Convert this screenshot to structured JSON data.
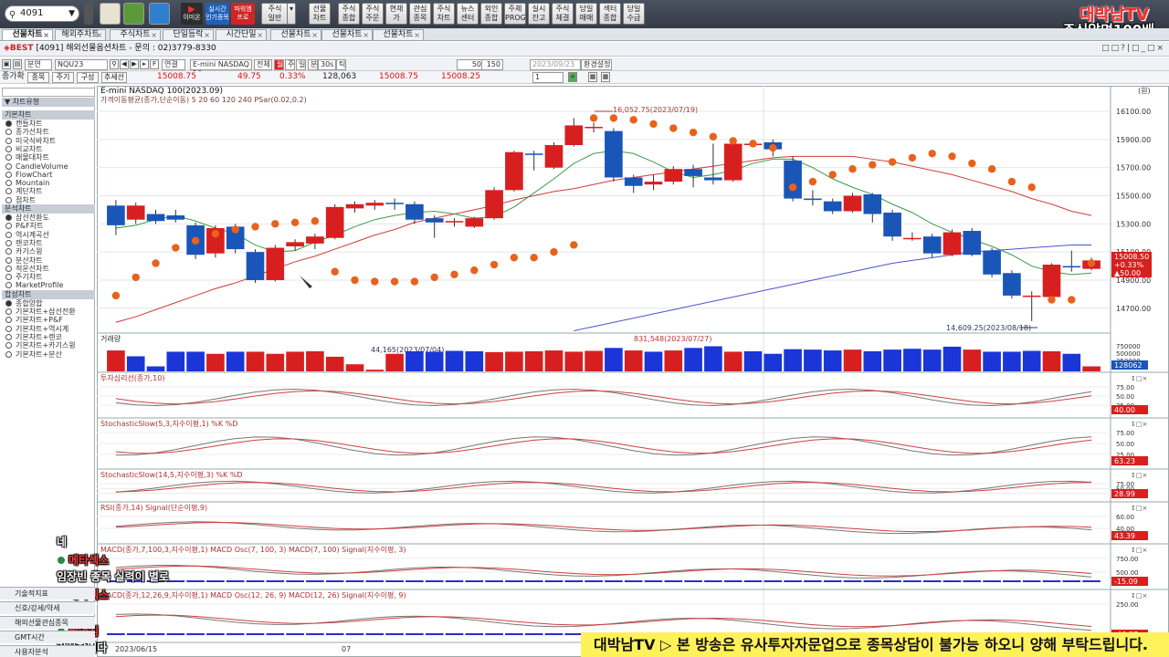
{
  "toolbar": {
    "code_value": "4091",
    "buttons": [
      "주식\n일반",
      "선물\n차트",
      "주식\n종합",
      "주식\n주문",
      "현재\n가",
      "관심\n종목",
      "주식\n차트",
      "뉴스\n센터",
      "외인\n종합",
      "주체\nPROG",
      "실시\n잔고",
      "주식\n체결",
      "당일\n매매",
      "섹터\n종합",
      "당일\n수급"
    ],
    "youtube_label": "이미온",
    "live_label": "실시간\n인기종목",
    "power_label": "파워엠\n프로"
  },
  "brand": {
    "line1": "대박남TV",
    "line2": "주식알면100배"
  },
  "tabs": [
    {
      "label": "선물차트",
      "active": true
    },
    {
      "label": "해외주차트"
    },
    {
      "label": "주식차트"
    },
    {
      "label": "단일등락"
    },
    {
      "label": "시간단일"
    },
    {
      "label": "선물차트"
    },
    {
      "label": "선물차트"
    },
    {
      "label": "선물차트"
    }
  ],
  "window": {
    "title": "[4091] 해외선물옵션차트 - 문의 : 02)3779-8330"
  },
  "controls": {
    "period": "분연",
    "symbol": "NQU23",
    "product": "E-mini NASDAQ 10",
    "all": "전체",
    "units": [
      "월",
      "주",
      "일",
      "분",
      "30s",
      "틱"
    ],
    "count1": "50",
    "count2": "150",
    "date": "2023/09/23",
    "setting": "환경설정",
    "page": "1"
  },
  "quote": {
    "label": "종가확",
    "btn1": "종목",
    "btn2": "주기",
    "btn3": "구성",
    "btn4": "추세선",
    "price": "15008.75",
    "change": "49.75",
    "pct": "0.33%",
    "volume": "128,063",
    "p2": "15008.75",
    "p3": "15008.25"
  },
  "sidebar": {
    "sections": [
      {
        "head": "차트유형",
        "items": []
      },
      {
        "head": "기본차트",
        "items": [
          "캔들차트",
          "종가선차트",
          "미국식바차트",
          "비교차트",
          "매물대차트",
          "CandleVolume",
          "FlowChart",
          "Mountain",
          "계단차트",
          "점차트"
        ]
      },
      {
        "head": "분석차트",
        "items": [
          "삼선전환도",
          "P&F차트",
          "역시계곡선",
          "렌코차트",
          "카기스윙",
          "분산차트",
          "적운선차트",
          "주기차트",
          "MarketProfile"
        ]
      },
      {
        "head": "합성차트",
        "items": [
          "종합양합",
          "기본차트+삼선전환",
          "기본차트+P&F",
          "기본차트+역시계",
          "기본차트+렌코",
          "기본차트+카기스윙",
          "기본차트+분산"
        ]
      }
    ],
    "bottom": [
      "기술적지표",
      "신호/강세/약세",
      "해외선물관심종목",
      "GMT시간",
      "사용자분석"
    ]
  },
  "chart_data": [
    {
      "type": "candlestick",
      "title": "E-mini NASDAQ 100(2023.09)",
      "legend": "가격이동평균(종가,단순이동) 5 20 60 120 240   PSar(0.02,0.2)",
      "y_ticks": [
        16100,
        15900,
        15700,
        15500,
        15300,
        15100,
        14900,
        14700
      ],
      "ylim": [
        14530,
        16230
      ],
      "annotations": [
        "16,052.75(2023/07/19)",
        "14,609.25(2023/08/18)"
      ],
      "current": [
        "15008.50",
        "+0.33%",
        "▲50.00"
      ],
      "candles": [
        {
          "o": 15430,
          "c": 15290,
          "h": 15470,
          "l": 15220
        },
        {
          "o": 15330,
          "c": 15430,
          "h": 15450,
          "l": 15300
        },
        {
          "o": 15370,
          "c": 15320,
          "h": 15400,
          "l": 15300
        },
        {
          "o": 15360,
          "c": 15330,
          "h": 15400,
          "l": 15310
        },
        {
          "o": 15290,
          "c": 15080,
          "h": 15310,
          "l": 15050
        },
        {
          "o": 15090,
          "c": 15270,
          "h": 15290,
          "l": 15060
        },
        {
          "o": 15280,
          "c": 15120,
          "h": 15300,
          "l": 15090
        },
        {
          "o": 15100,
          "c": 14900,
          "h": 15120,
          "l": 14880
        },
        {
          "o": 14900,
          "c": 15130,
          "h": 15150,
          "l": 14890
        },
        {
          "o": 15140,
          "c": 15170,
          "h": 15190,
          "l": 15110
        },
        {
          "o": 15160,
          "c": 15210,
          "h": 15230,
          "l": 15120
        },
        {
          "o": 15200,
          "c": 15420,
          "h": 15440,
          "l": 15190
        },
        {
          "o": 15410,
          "c": 15440,
          "h": 15460,
          "l": 15380
        },
        {
          "o": 15430,
          "c": 15450,
          "h": 15470,
          "l": 15400
        },
        {
          "o": 15450,
          "c": 15440,
          "h": 15480,
          "l": 15400
        },
        {
          "o": 15440,
          "c": 15330,
          "h": 15460,
          "l": 15300
        },
        {
          "o": 15340,
          "c": 15310,
          "h": 15360,
          "l": 15200
        },
        {
          "o": 15310,
          "c": 15320,
          "h": 15340,
          "l": 15280
        },
        {
          "o": 15280,
          "c": 15340,
          "h": 15350,
          "l": 15270
        },
        {
          "o": 15340,
          "c": 15540,
          "h": 15560,
          "l": 15330
        },
        {
          "o": 15540,
          "c": 15810,
          "h": 15820,
          "l": 15530
        },
        {
          "o": 15800,
          "c": 15790,
          "h": 15820,
          "l": 15680
        },
        {
          "o": 15700,
          "c": 15860,
          "h": 15880,
          "l": 15690
        },
        {
          "o": 15860,
          "c": 16000,
          "h": 16052,
          "l": 15850
        },
        {
          "o": 15990,
          "c": 15990,
          "h": 16020,
          "l": 15950
        },
        {
          "o": 15960,
          "c": 15630,
          "h": 15980,
          "l": 15600
        },
        {
          "o": 15630,
          "c": 15570,
          "h": 15650,
          "l": 15520
        },
        {
          "o": 15580,
          "c": 15600,
          "h": 15650,
          "l": 15540
        },
        {
          "o": 15600,
          "c": 15690,
          "h": 15710,
          "l": 15580
        },
        {
          "o": 15690,
          "c": 15640,
          "h": 15720,
          "l": 15560
        },
        {
          "o": 15630,
          "c": 15610,
          "h": 15870,
          "l": 15580
        },
        {
          "o": 15610,
          "c": 15870,
          "h": 15890,
          "l": 15600
        },
        {
          "o": 15870,
          "c": 15870,
          "h": 15890,
          "l": 15850
        },
        {
          "o": 15880,
          "c": 15830,
          "h": 15900,
          "l": 15780
        },
        {
          "o": 15750,
          "c": 15480,
          "h": 15780,
          "l": 15460
        },
        {
          "o": 15480,
          "c": 15470,
          "h": 15540,
          "l": 15430
        },
        {
          "o": 15460,
          "c": 15390,
          "h": 15480,
          "l": 15370
        },
        {
          "o": 15390,
          "c": 15500,
          "h": 15520,
          "l": 15380
        },
        {
          "o": 15510,
          "c": 15370,
          "h": 15520,
          "l": 15310
        },
        {
          "o": 15380,
          "c": 15210,
          "h": 15400,
          "l": 15180
        },
        {
          "o": 15200,
          "c": 15200,
          "h": 15240,
          "l": 15180
        },
        {
          "o": 15210,
          "c": 15090,
          "h": 15230,
          "l": 15060
        },
        {
          "o": 15080,
          "c": 15240,
          "h": 15260,
          "l": 15070
        },
        {
          "o": 15250,
          "c": 15080,
          "h": 15270,
          "l": 15070
        },
        {
          "o": 15110,
          "c": 14940,
          "h": 15130,
          "l": 14920
        },
        {
          "o": 14950,
          "c": 14790,
          "h": 14970,
          "l": 14770
        },
        {
          "o": 14790,
          "c": 14790,
          "h": 14820,
          "l": 14609
        },
        {
          "o": 14780,
          "c": 15010,
          "h": 15020,
          "l": 14770
        },
        {
          "o": 15000,
          "c": 14990,
          "h": 15110,
          "l": 14960
        },
        {
          "o": 14980,
          "c": 15040,
          "h": 15060,
          "l": 14970
        }
      ],
      "psar": [
        14790,
        14920,
        15020,
        15130,
        15180,
        15230,
        15260,
        15280,
        15300,
        15310,
        15320,
        14960,
        14900,
        14890,
        14890,
        14890,
        14920,
        14940,
        14970,
        15010,
        15060,
        15060,
        15100,
        15150,
        16052,
        16052,
        16040,
        16010,
        15980,
        15950,
        15920,
        15890,
        15870,
        15840,
        15560,
        15600,
        15650,
        15690,
        15720,
        15740,
        15770,
        15800,
        15780,
        15730,
        15690,
        15600,
        15560,
        14760,
        14760,
        15020
      ],
      "ma_series": [
        {
          "name": "ma20",
          "values": [
            14600,
            14640,
            14690,
            14740,
            14790,
            14840,
            14880,
            14930,
            14980,
            15030,
            15070,
            15120,
            15170,
            15220,
            15260,
            15310,
            15340,
            15370,
            15400,
            15430,
            15470,
            15500,
            15530,
            15550,
            15580,
            15610,
            15630,
            15650,
            15670,
            15690,
            15710,
            15730,
            15750,
            15770,
            15780,
            15780,
            15780,
            15780,
            15760,
            15740,
            15710,
            15680,
            15650,
            15610,
            15570,
            15530,
            15480,
            15440,
            15390,
            15360
          ]
        },
        {
          "name": "ma5",
          "values": [
            15270,
            15290,
            15330,
            15360,
            15320,
            15270,
            15230,
            15150,
            15100,
            15110,
            15170,
            15220,
            15280,
            15330,
            15360,
            15380,
            15390,
            15370,
            15340,
            15350,
            15420,
            15520,
            15620,
            15730,
            15800,
            15820,
            15800,
            15740,
            15670,
            15630,
            15650,
            15680,
            15730,
            15760,
            15760,
            15700,
            15620,
            15560,
            15510,
            15440,
            15380,
            15300,
            15240,
            15190,
            15140,
            15080,
            15000,
            14960,
            14940,
            14950
          ]
        },
        {
          "name": "ma60",
          "values": [
            null,
            null,
            null,
            null,
            null,
            null,
            null,
            null,
            null,
            null,
            null,
            null,
            null,
            null,
            null,
            null,
            null,
            null,
            null,
            null,
            null,
            null,
            null,
            14540,
            14570,
            14600,
            14630,
            14660,
            14690,
            14720,
            14750,
            14780,
            14810,
            14840,
            14870,
            14900,
            14930,
            14960,
            14990,
            15020,
            15040,
            15060,
            15080,
            15100,
            15110,
            15120,
            15130,
            15140,
            15150,
            15150
          ]
        }
      ]
    },
    {
      "type": "bar",
      "title": "거래량",
      "annotations": [
        "44,165(2023/07/04)",
        "831,548(2023/07/27)"
      ],
      "y_ticks": [
        "750000",
        "500000",
        "250000"
      ],
      "current": "128062",
      "values": [
        500,
        360,
        120,
        470,
        470,
        420,
        470,
        470,
        420,
        470,
        480,
        350,
        170,
        40,
        420,
        480,
        470,
        490,
        480,
        460,
        470,
        480,
        500,
        470,
        490,
        560,
        500,
        470,
        500,
        560,
        600,
        470,
        480,
        420,
        530,
        520,
        500,
        520,
        480,
        520,
        540,
        520,
        590,
        520,
        470,
        470,
        490,
        480,
        420,
        120
      ],
      "colors": [
        "up",
        "down",
        "down",
        "down",
        "down",
        "up",
        "down",
        "up",
        "up",
        "up",
        "up",
        "up",
        "up",
        "up",
        "up",
        "down",
        "down",
        "down",
        "down",
        "up",
        "up",
        "up",
        "up",
        "up",
        "up",
        "down",
        "up",
        "down",
        "up",
        "down",
        "down",
        "up",
        "down",
        "down",
        "down",
        "down",
        "down",
        "up",
        "down",
        "down",
        "down",
        "down",
        "down",
        "up",
        "down",
        "down",
        "down",
        "up",
        "down",
        "up"
      ]
    }
  ],
  "indicators": [
    {
      "title": "투자심리선(종가,10)",
      "ticks": [
        "75.00",
        "50.00",
        "25.00"
      ],
      "current": "40.00"
    },
    {
      "title": "StochasticSlow(5,3,지수이평,1) %K %D",
      "ticks": [
        "75.00",
        "50.00",
        "25.00"
      ],
      "current": "63.23"
    },
    {
      "title": "StochasticSlow(14,5,지수이평,3) %K %D",
      "ticks": [
        "75.00",
        "50.00",
        "25.00"
      ],
      "current": "28.99"
    },
    {
      "title": "RSI(종가,14) Signal(단순이평,9)",
      "ticks": [
        "60.00",
        "40.00"
      ],
      "current": "43.39"
    },
    {
      "title": "MACD(종가,7,100,3,지수이평,1) MACD Osc(7, 100, 3) MACD(7, 100) Signal(지수이평, 3)",
      "ticks": [
        "750.00",
        "500.00"
      ],
      "current": "-15.09"
    },
    {
      "title": "MACD(종가,12,26,9,지수이평,1) MACD Osc(12, 26, 9) MACD(12, 26) Signal(지수이평, 9)",
      "ticks": [
        "250.00"
      ],
      "current": "-46.87"
    }
  ],
  "x_axis": [
    "2023/06/15",
    "07"
  ],
  "axis_top_label": "(원)",
  "chat": {
    "lines": [
      {
        "user": "",
        "text": "네"
      },
      {
        "user": "메타섹스",
        "text": "임장빈 종목 실력이 별로"
      },
      {
        "user": "메타섹스",
        "text": ""
      },
      {
        "user": "쌈억킴",
        "text": "감사합니다"
      }
    ]
  },
  "banner": "대박남TV ▷ 본 방송은 유사투자자문업으로 종목상담이 불가능 하오니 양해 부탁드립니다.",
  "colors": {
    "up": "#d81f1f",
    "down": "#1a56b8",
    "psar": "#e8621b",
    "ma5": "#3c9a4a",
    "ma20": "#d03b3b",
    "ma60": "#4a55cc"
  }
}
